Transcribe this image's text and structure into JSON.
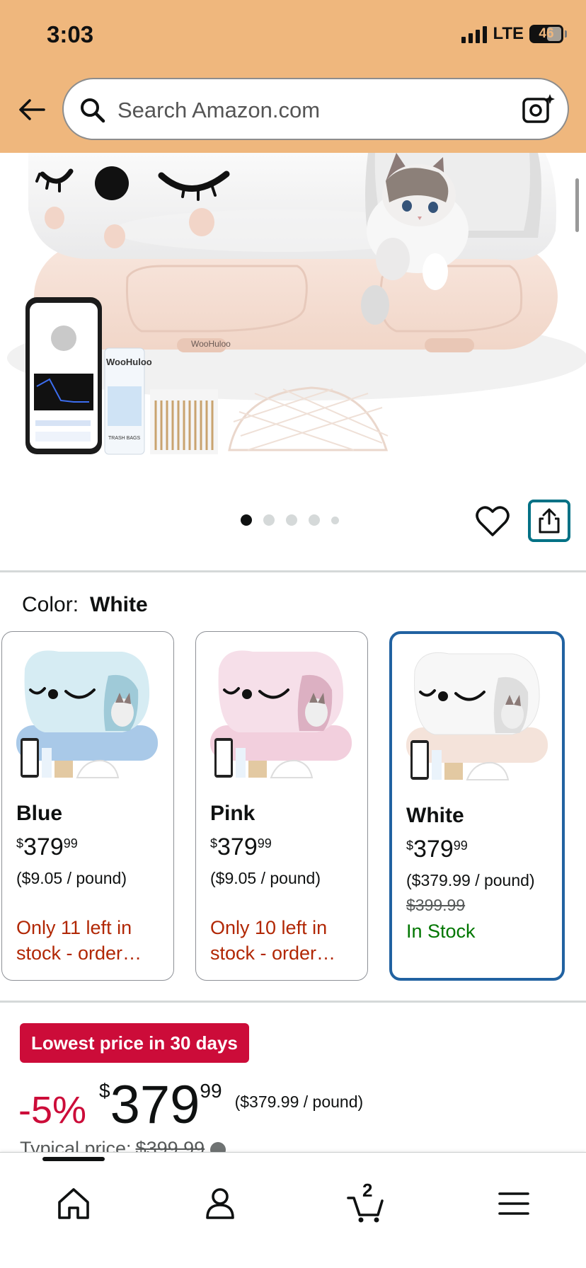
{
  "status_bar": {
    "time": "3:03",
    "network": "LTE",
    "battery": "46"
  },
  "search": {
    "placeholder": "Search Amazon.com"
  },
  "hero": {
    "brand_text": "WooHuloo",
    "can_label": "WooHuloo",
    "can_sublabel": "TRASH BAGS",
    "image_count": 5,
    "active_image_index": 0
  },
  "color": {
    "label": "Color:",
    "selected": "White"
  },
  "swatches": [
    {
      "name": "Blue",
      "currency": "$",
      "whole": "379",
      "cents": "99",
      "unit_price": "($9.05 / pound)",
      "list_price": "",
      "stock": "Only 11 left in stock - order…",
      "stock_type": "low",
      "body_color": "#d6ecf3",
      "base_color": "#a9c9e8"
    },
    {
      "name": "Pink",
      "currency": "$",
      "whole": "379",
      "cents": "99",
      "unit_price": "($9.05 / pound)",
      "list_price": "",
      "stock": "Only 10 left in stock - order…",
      "stock_type": "low",
      "body_color": "#f6dfe9",
      "base_color": "#f2cfdd"
    },
    {
      "name": "White",
      "currency": "$",
      "whole": "379",
      "cents": "99",
      "unit_price": "($379.99 / pound)",
      "list_price": "$399.99",
      "stock": "In Stock",
      "stock_type": "in",
      "body_color": "#f7f7f7",
      "base_color": "#f4e3da"
    }
  ],
  "deal": {
    "badge": "Lowest price in 30 days",
    "discount": "-5%",
    "currency": "$",
    "whole": "379",
    "cents": "99",
    "unit_price": "($379.99 / pound)",
    "typical_label": "Typical price:",
    "typical_price": "$399.99"
  },
  "bottom_nav": {
    "cart_count": "2"
  },
  "colors": {
    "header": "#efb77d",
    "deal_red": "#cc0c39",
    "stock_red": "#b12704",
    "stock_green": "#007600",
    "teal": "#007185",
    "selected_border": "#2162a1"
  },
  "icons": [
    "back-arrow-icon",
    "search-icon",
    "camera-icon",
    "heart-icon",
    "share-icon",
    "home-icon",
    "account-icon",
    "cart-icon",
    "menu-icon"
  ]
}
